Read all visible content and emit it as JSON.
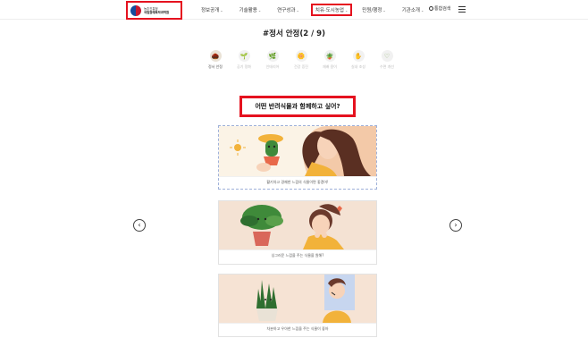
{
  "header": {
    "logo_lines": [
      "농촌진흥청",
      "국립원예특작과학원"
    ],
    "nav": [
      {
        "label": "정보공개",
        "active": false
      },
      {
        "label": "기술활용",
        "active": false
      },
      {
        "label": "연구성과",
        "active": false
      },
      {
        "label": "치유·도시농업",
        "active": true
      },
      {
        "label": "민원/행정",
        "active": false
      },
      {
        "label": "기관소개",
        "active": false
      }
    ],
    "search_label": "통합검색"
  },
  "section_title": "#정서 안정(2 / 9)",
  "categories": [
    {
      "label": "정서 안정",
      "icon": "🌰",
      "active": true
    },
    {
      "label": "공기 정화",
      "icon": "🌱",
      "active": false
    },
    {
      "label": "인테리어",
      "icon": "🌿",
      "active": false
    },
    {
      "label": "건강 증진",
      "icon": "🌼",
      "active": false
    },
    {
      "label": "재배 용이",
      "icon": "🪴",
      "active": false
    },
    {
      "label": "실내 조성",
      "icon": "✋",
      "active": false
    },
    {
      "label": "수면 개선",
      "icon": "♡",
      "active": false
    }
  ],
  "question": "어떤 반려식물과 함께하고 싶어?",
  "cards": [
    {
      "caption": "활기차고 경쾌한 느낌의 식물이면 좋겠어!"
    },
    {
      "caption": "싱그러운 느낌을 주는 식물을 원해?"
    },
    {
      "caption": "차분하고 우아한 느낌을 주는 식물이 좋아"
    }
  ],
  "arrows": {
    "prev": "‹",
    "next": "›"
  },
  "colors": {
    "highlight": "#e5121f",
    "accent": "#f2b23a",
    "plant_green": "#3f8a3a"
  }
}
